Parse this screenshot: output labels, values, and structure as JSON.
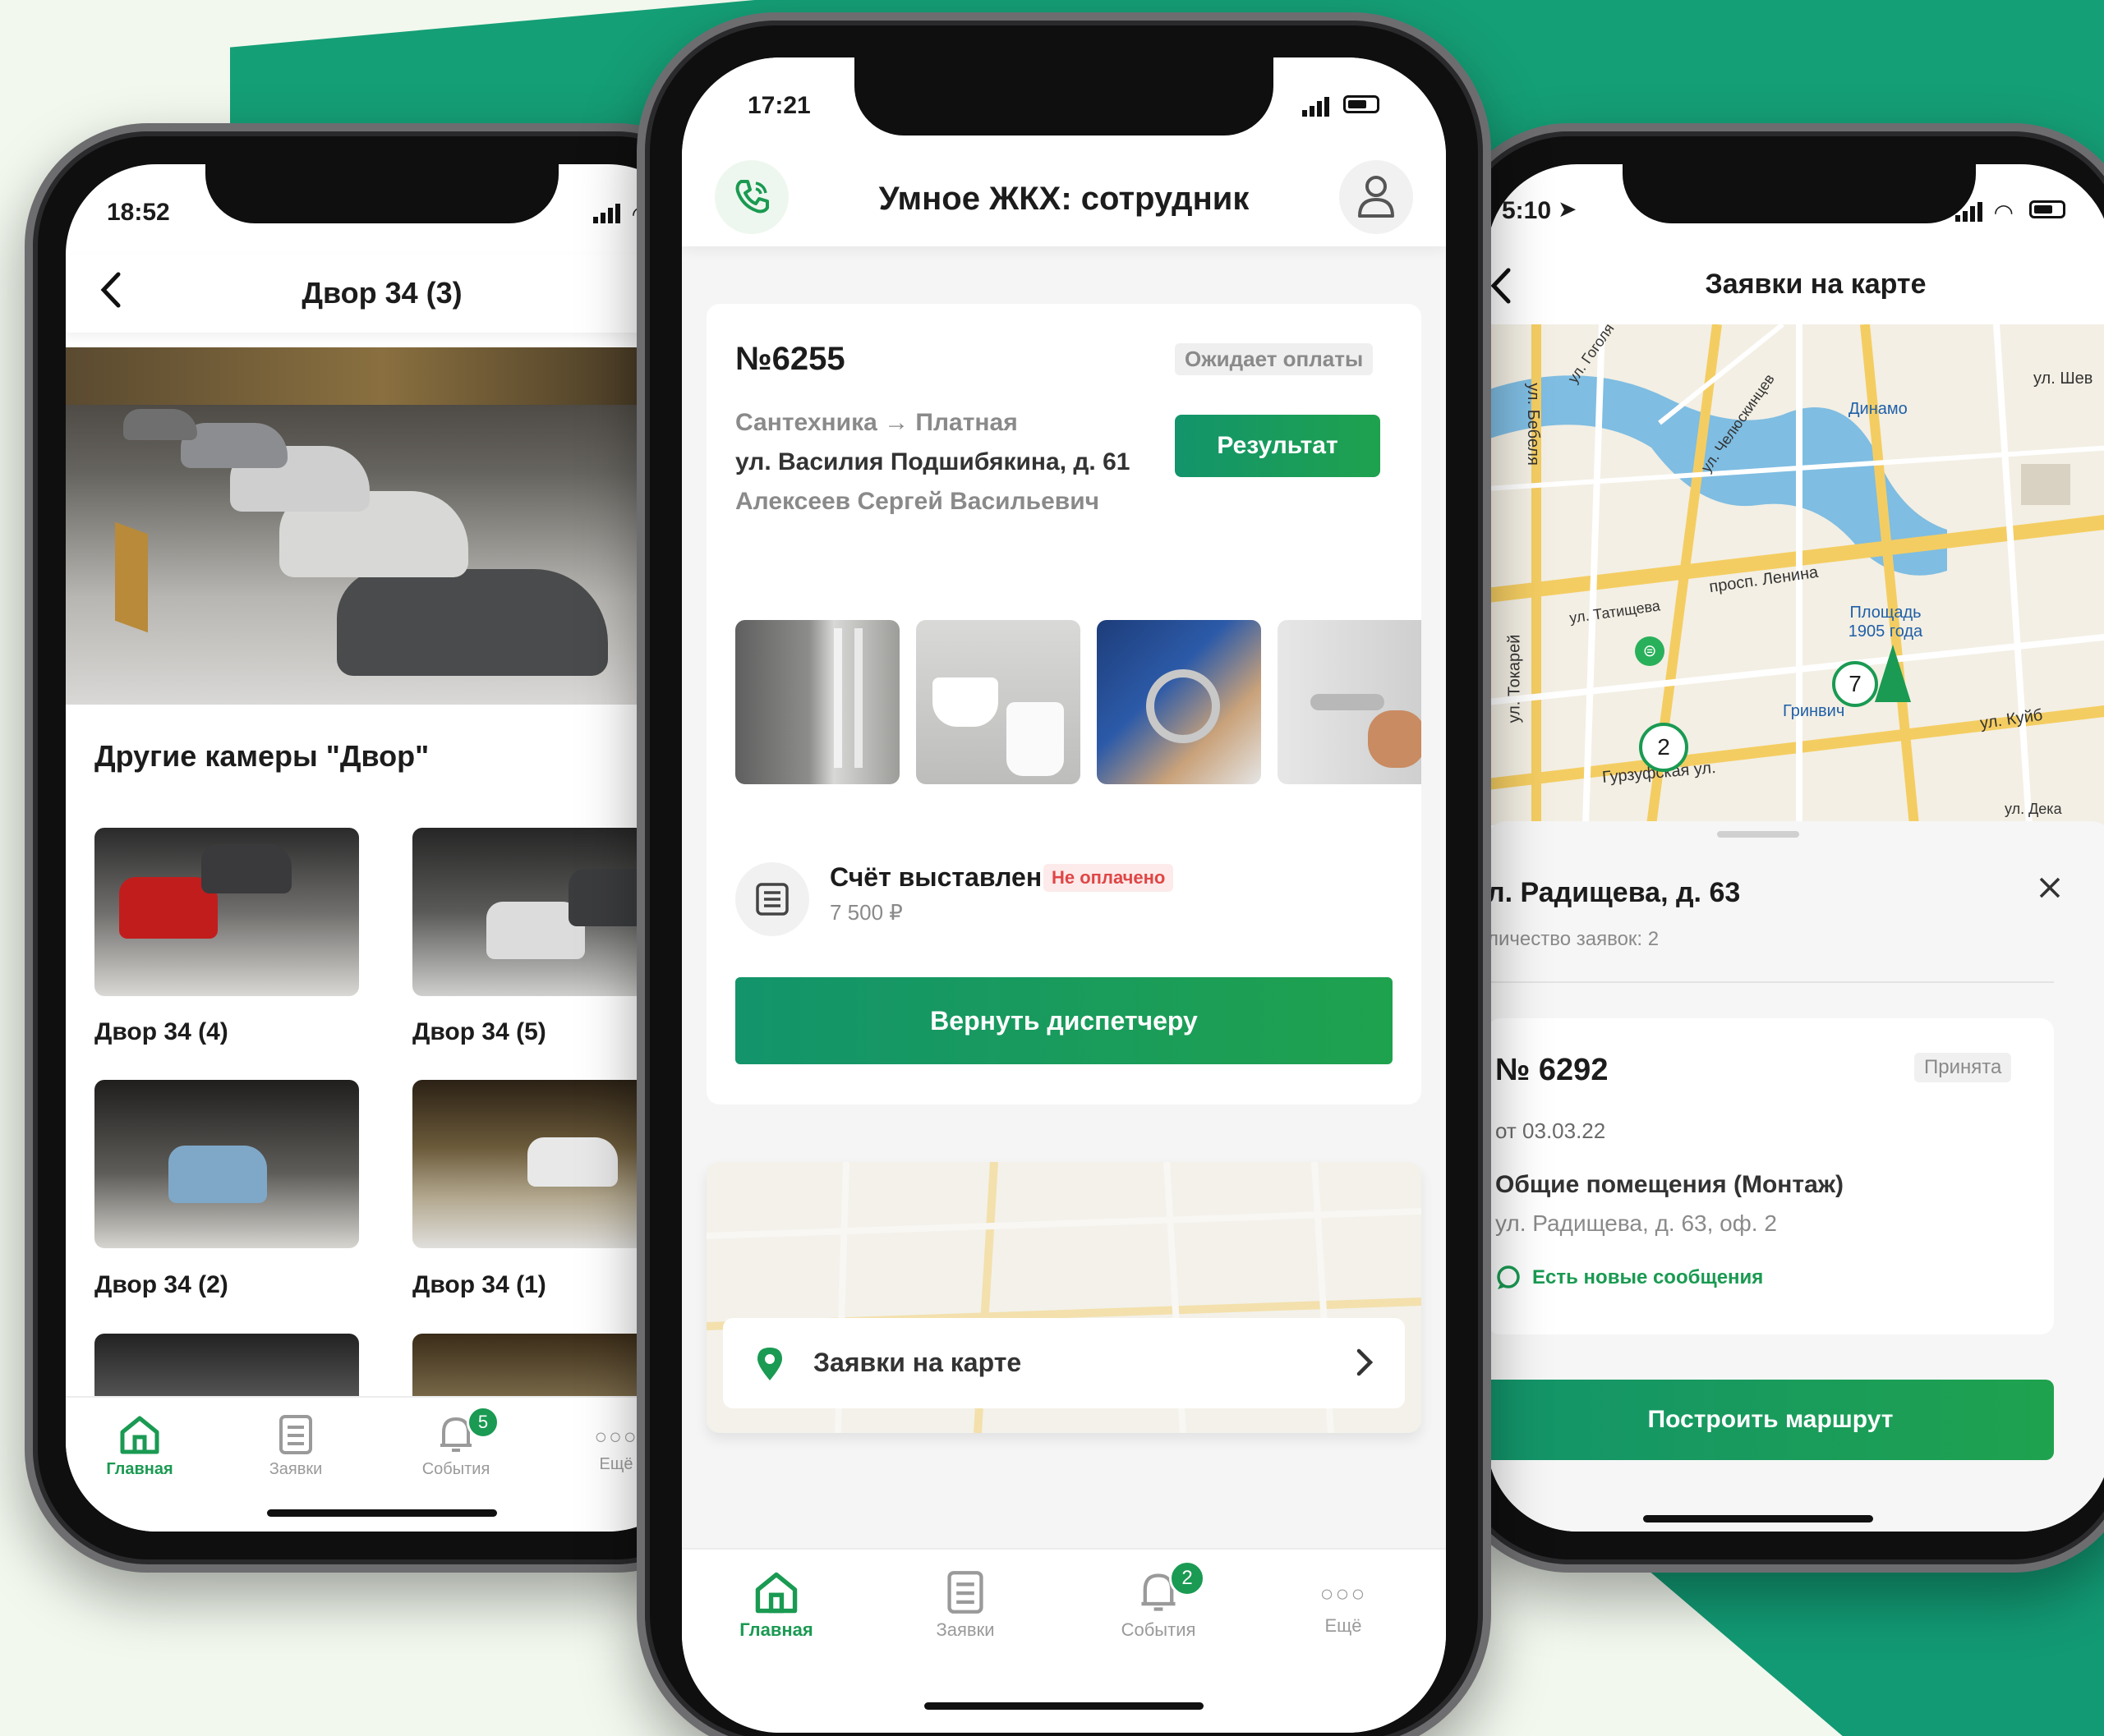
{
  "colors": {
    "brand": "#1a9a52",
    "bg_teal": "#159f76",
    "page_bg": "#f2f8ee"
  },
  "left": {
    "time": "18:52",
    "title": "Двор 34 (3)",
    "section_title": "Другие камеры \"Двор\"",
    "cameras": [
      "Двор 34 (4)",
      "Двор 34 (5)",
      "Двор 34 (2)",
      "Двор 34 (1)"
    ],
    "tabs": [
      {
        "label": "Главная",
        "icon": "home-icon"
      },
      {
        "label": "Заявки",
        "icon": "document-icon"
      },
      {
        "label": "События",
        "icon": "bell-icon"
      },
      {
        "label": "Ещё",
        "icon": "more-icon"
      }
    ],
    "events_badge": "5"
  },
  "center": {
    "time": "17:21",
    "app_title": "Умное ЖКХ: сотрудник",
    "order": {
      "number": "№6255",
      "status": "Ожидает оплаты",
      "category": "Сантехника → Платная",
      "address": "ул. Василия Подшибякина, д. 61",
      "person": "Алексеев Сергей Васильевич",
      "result_button": "Результат"
    },
    "invoice": {
      "title": "Счёт выставлен",
      "status": "Не оплачено",
      "amount": "7 500 ₽"
    },
    "return_button": "Вернуть диспетчеру",
    "map_link": "Заявки на карте",
    "tabs": [
      {
        "label": "Главная",
        "icon": "home-icon"
      },
      {
        "label": "Заявки",
        "icon": "document-icon"
      },
      {
        "label": "События",
        "icon": "bell-icon"
      },
      {
        "label": "Ещё",
        "icon": "more-icon"
      }
    ],
    "events_badge": "2"
  },
  "right": {
    "time": "5:10",
    "title": "Заявки на карте",
    "map_labels": [
      "ул. Гоголя",
      "ул. Челюскинцев",
      "ул. Бебеля",
      "Динамо",
      "ул. Шев",
      "ул. Татищева",
      "просп. Ленина",
      "Площадь 1905 года",
      "ул. Токарей",
      "Гринвич",
      "ул. Куйб",
      "Гурзуфская ул.",
      "ул. Дека"
    ],
    "clusters": [
      "7",
      "2"
    ],
    "address": "л. Радищева, д. 63",
    "count_text": "личество заявок: 2",
    "request": {
      "number": "№ 6292",
      "status": "Принята",
      "date": "от 03.03.22",
      "category": "Общие помещения (Монтаж)",
      "address": "ул. Радищева, д. 63, оф. 2",
      "messages": "Есть новые сообщения"
    },
    "route_button": "Построить маршрут"
  }
}
